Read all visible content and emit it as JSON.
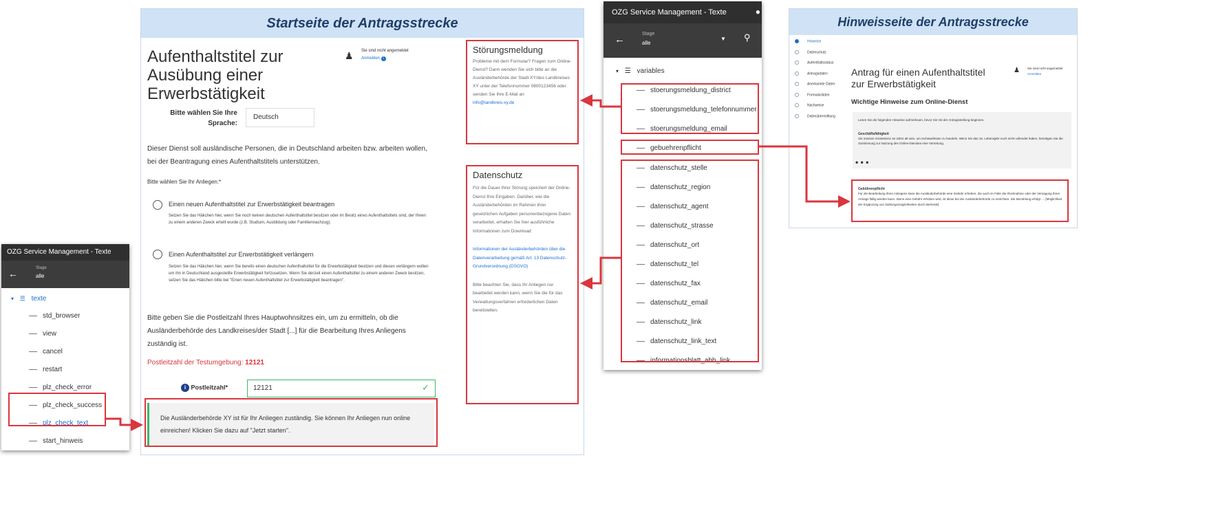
{
  "start_page": {
    "banner": "Startseite der Antragsstrecke",
    "title": "Aufenthaltstitel zur Ausübung einer Erwerbstätigkeit",
    "login_text": "Sie sind nicht angemeldet",
    "login_link": "Anmelden",
    "language_label": "Bitte wählen Sie Ihre Sprache:",
    "language_value": "Deutsch",
    "intro": "Dieser Dienst soll ausländische Personen, die in Deutschland arbeiten bzw. arbeiten wollen, bei der Beantragung eines Aufenthaltstitels unterstützen.",
    "choose_label": "Bitte wählen Sie Ihr Anliegen:*",
    "option1_label": "Einen neuen Aufenthaltstitel zur Erwerbstätigkeit beantragen",
    "option1_desc": "Setzen Sie das Häkchen hier, wenn Sie noch keinen deutschen Aufenthaltstitel besitzen oder im Besitz eines Aufenthaltstitels sind, der Ihnen zu einem anderen Zweck erteilt wurde (z.B. Studium, Ausbildung oder Familiennachzug).",
    "option2_label": "Einen Aufenthaltstitel zur Erwerbstätigkeit verlängern",
    "option2_desc": "Setzen Sie das Häkchen hier, wenn Sie bereits einen deutschen Aufenthaltstitel für die Erwerbstätigkeit besitzen und diesen verlängern wollen um ihn in Deutschland ausgestellte Erwerbstätigkeit fortzusetzen. Wenn Sie derzeit einen Aufenthaltstitel zu einem anderen Zweck besitzen, setzen Sie das Häkchen bitte bei \"Einen neuen Aufenthaltstitel zur Erwerbstätigkeit beantragen\".",
    "postal_intro": "Bitte geben Sie die Postleitzahl Ihres Hauptwohnsitzes ein, um zu ermitteln, ob die Ausländerbehörde des Landkreises/der Stadt [...] für die Bearbeitung Ihres Anliegens zuständig ist.",
    "test_label": "Postleitzahl der Testumgebung:",
    "test_value": "12121",
    "postal_label": "Postleitzahl*",
    "postal_value": "12121",
    "success_msg": "Die Ausländerbehörde XY ist für Ihr Anliegen zuständig. Sie können Ihr Anliegen nun online einreichen! Klicken Sie dazu auf \"Jetzt starten\"."
  },
  "stoerung_panel": {
    "title": "Störungsmeldung",
    "text": "Probleme mit dem Formular? Fragen zum Online-Dienst? Dann wenden Sie sich bitte an die Ausländerbehörde der Stadt XY/des Landkreises XY unter der Telefonnummer 0800123456 oder senden Sie Ihre E-Mail an",
    "email": "info@landkreis-xy.de"
  },
  "datenschutz_panel": {
    "title": "Datenschutz",
    "text": "Für die Dauer Ihrer Störung speichert der Online-Dienst Ihre Eingaben. Darüber, wie die Ausländerbehörden im Rahmen ihrer gesetzlichen Aufgaben personenbezogene Daten verarbeitet, erhalten Sie hier ausführliche Informationen zum Download:",
    "link": "Informationen der Ausländerbehörden über die Datenverarbeitung gemäß Art. 13 Datenschutz-Grundverordnung (DSGVO)",
    "note": "Bitte beachten Sie, dass Ihr Anliegen nur bearbeitet werden kann, wenn Sie die für das Verwaltungsverfahren erforderlichen Daten bereitstellen."
  },
  "tool_right": {
    "title": "OZG Service Management - Texte",
    "page_small": "Stage",
    "page_value": "alle",
    "root": "variables",
    "items": [
      "stoerungsmeldung_district",
      "stoerungsmeldung_telefonnummer",
      "stoerungsmeldung_email",
      "gebuehrenpflicht",
      "datenschutz_stelle",
      "datenschutz_region",
      "datenschutz_agent",
      "datenschutz_strasse",
      "datenschutz_ort",
      "datenschutz_tel",
      "datenschutz_fax",
      "datenschutz_email",
      "datenschutz_link",
      "datenschutz_link_text",
      "informationsblatt_abh_link"
    ]
  },
  "tool_left": {
    "title": "OZG Service Management - Texte",
    "page_small": "Stage",
    "page_value": "alle",
    "root": "texte",
    "items": [
      "std_browser",
      "view",
      "cancel",
      "restart",
      "plz_check_error",
      "plz_check_success",
      "plz_check_text",
      "start_hinweis"
    ]
  },
  "hinweis_page": {
    "banner": "Hinweisseite der Antragsstrecke",
    "nav": [
      "Hinweise",
      "Datenschutz",
      "Aufenthaltsstatus",
      "Antragsdaten",
      "Anerkannte Daten",
      "Formulardaten",
      "Nachweise",
      "Datenübermittlung"
    ],
    "title": "Antrag für einen Aufenthaltstitel zur Erwerbstätigkeit",
    "login_text": "Sie sind nicht angemeldet",
    "login_link": "Anmelden",
    "subtitle": "Wichtige Hinweise zum Online-Dienst",
    "box_intro": "Lesen Sie die folgenden Hinweise aufmerksam, bevor Sie mit der Antragsstellung beginnen.",
    "box_heading": "Geschäftsfähigkeit",
    "box_text": "Sie müssen mindestens 16 Jahre alt sein, um rechtswirksam zu handeln. Wenn Sie das 16. Lebensjahr noch nicht vollendet haben, benötigen Sie die Zustimmung zur Nutzung des Online-Dienstes eine Vertretung.",
    "ellipsis": "• • •",
    "fee_heading": "Gebührenpflicht",
    "fee_text": "Für die Bearbeitung Ihres Anliegens kann die Ausländerbehörde eine Gebühr erheben, die auch im Falle der Rücknahme oder der Versagung Ihres Antrags fällig werden kann. Wenn eine Gebühr erhoben wird, ist diese bei der Ausländerbehörde zu entrichten. Die Bezahlung erfolgt .... [Möglichkeit der Ergänzung von Zahlungsmöglichkeiten durch Behörde]"
  },
  "colors": {
    "accent_red": "#d9363e",
    "banner_blue": "#cfe2f6",
    "dark_bar": "#2f2f2f",
    "success_green": "#3cb86b"
  }
}
